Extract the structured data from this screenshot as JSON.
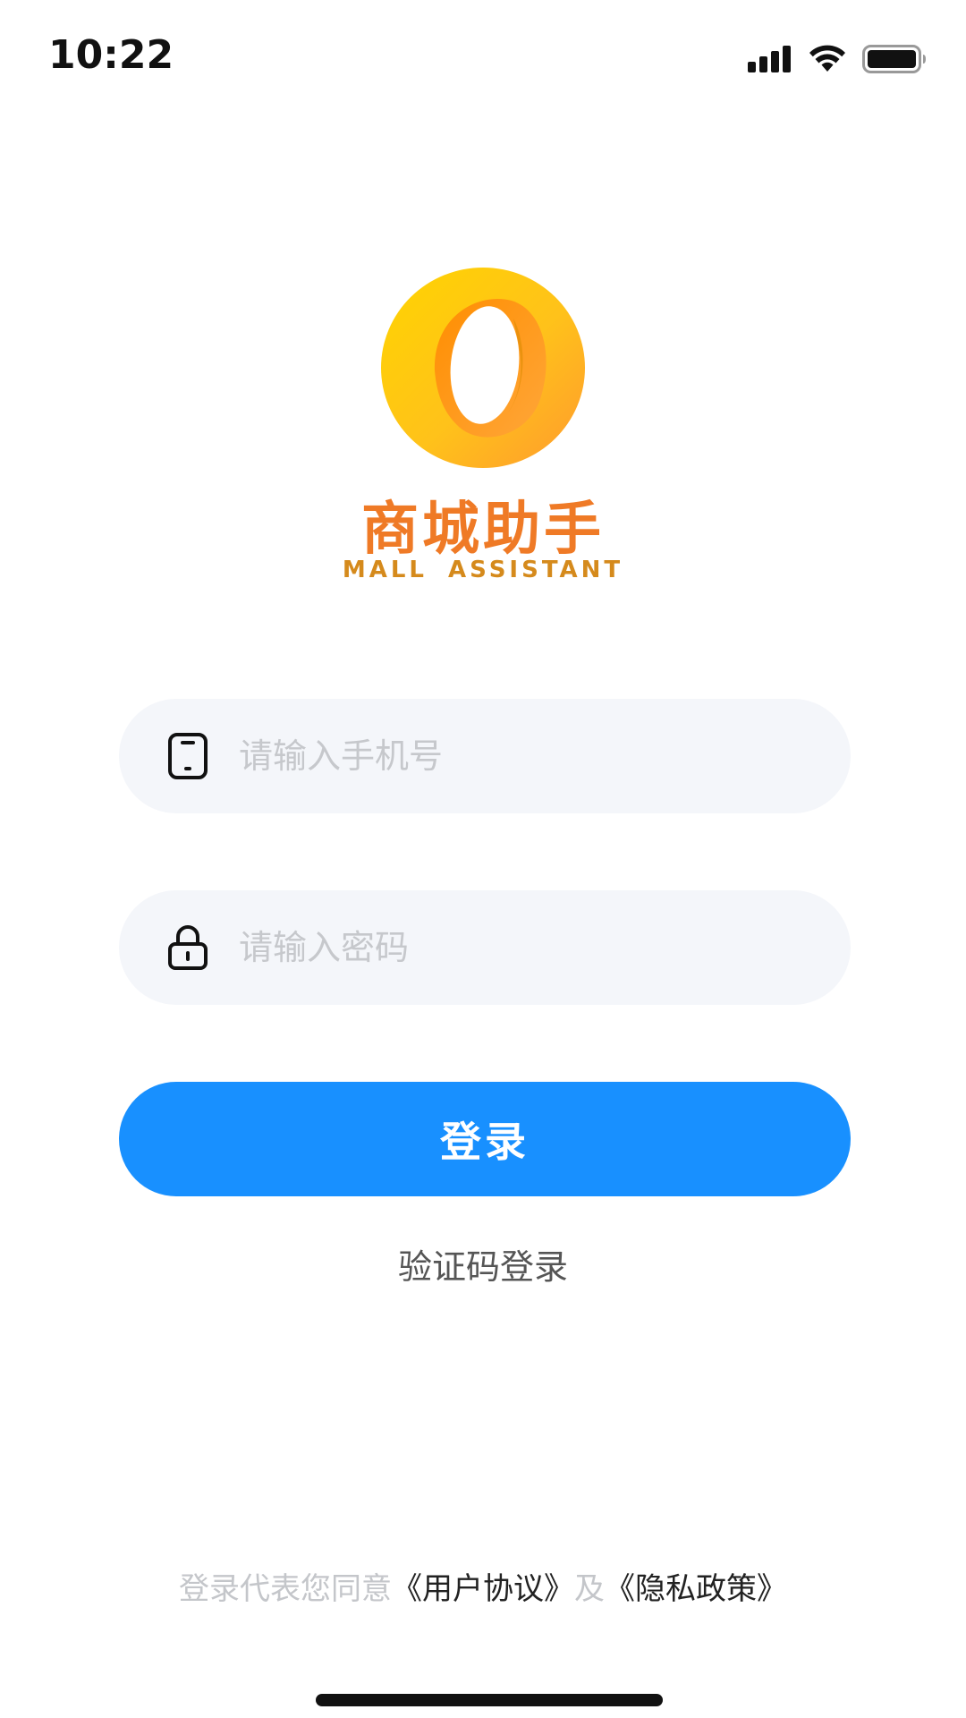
{
  "status_bar": {
    "time": "10:22"
  },
  "brand": {
    "name_cn": "商城助手",
    "name_en": "MALL  ASSISTANT"
  },
  "form": {
    "phone_placeholder": "请输入手机号",
    "password_placeholder": "请输入密码",
    "login_label": "登录",
    "sms_login_label": "验证码登录"
  },
  "agreement": {
    "prefix": "登录代表您同意",
    "user_agreement": "《用户协议》",
    "conjunction": "及",
    "privacy_policy": "《隐私政策》"
  },
  "colors": {
    "primary": "#1890ff",
    "brand_orange": "#ef7a26",
    "brand_gold": "#d58a1c",
    "field_bg": "#f4f6fa",
    "placeholder": "#c6c8cc"
  },
  "icons": {
    "phone": "phone-icon",
    "lock": "lock-icon"
  }
}
